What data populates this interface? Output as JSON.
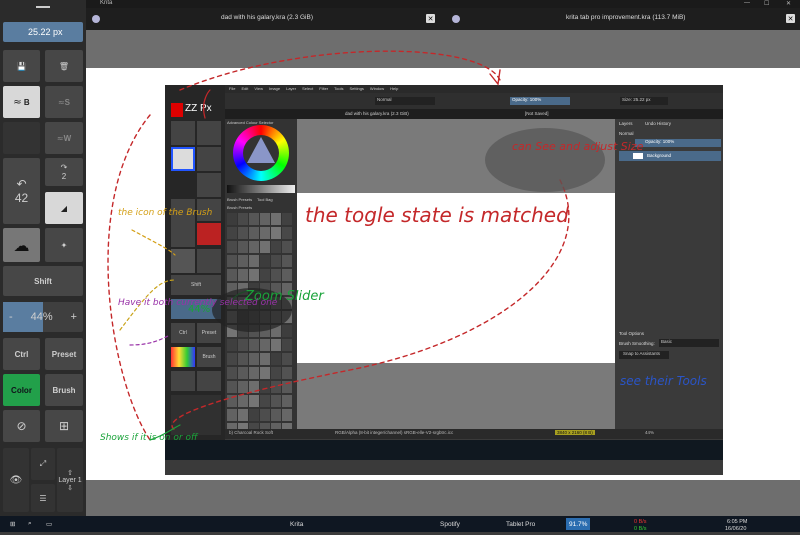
{
  "window": {
    "app_title": "Krita",
    "controls": [
      "—",
      "☐",
      "✕"
    ]
  },
  "tabs": [
    {
      "label": "dad with his galary.kra (2.3 GiB)",
      "close": "✕"
    },
    {
      "label": "krita  tab pro improvement.kra (113.7 MiB)",
      "close": "✕"
    }
  ],
  "toolbox": {
    "menu_icon": "hamburger-icon",
    "size_value": "25.22 px",
    "brush_b_label": "B",
    "brush_s_label": "S",
    "brush_w_label": "W",
    "undo_count": "42",
    "redo_count": "2",
    "shift_label": "Shift",
    "zoom_value": "44%",
    "zoom_minus": "-",
    "zoom_plus": "+",
    "ctrl_label": "Ctrl",
    "preset_label": "Preset",
    "color_label": "Color",
    "brush_label": "Brush",
    "layer_label": "Layer 1",
    "accent_green": "#22a04a"
  },
  "embedded": {
    "menu_items": [
      "File",
      "Edit",
      "View",
      "Image",
      "Layer",
      "Select",
      "Filter",
      "Tools",
      "Settings",
      "Window",
      "Help"
    ],
    "blend_mode": "Normal",
    "opacity": "Opacity: 100%",
    "size": "Size: 25.22 px",
    "tab_label": "dad with his galary.kra (2.3 GiB)",
    "not_saved": "[Not Saved]",
    "docker_title": "Advanced Colour Selector",
    "brush_presets_tab": "Brush Presets",
    "toolbox_tab": "Tool Bag",
    "brush_presets_header": "Brush Presets",
    "tag_label": "Tag",
    "layers_tab": "Layers",
    "undo_tab": "Undo History",
    "layer_mode": "Normal",
    "layer_opacity": "Opacity: 100%",
    "layer_name": "Background",
    "tool_options": "Tool Options",
    "brush_smoothing": "Brush Smoothing:",
    "smoothing_value": "Basic",
    "snap_label": "Snap to Assistants",
    "status_text": "RGB/Alpha (8-bit integer/channel)  sRGB-elle-V2-srgbtrc.icc",
    "brush_name": "b) Charcoal Rock Soft",
    "dimensions": "3840 x 2160 (8 B)",
    "zoom": "44%",
    "embed_zz": "ZZ Px",
    "shift": "Shift",
    "preset": "Preset",
    "brush": "Brush",
    "ctrl": "Ctrl"
  },
  "annotations": {
    "toggle_state": "the togle state is matched",
    "can_see_size": "can See and adjust Size",
    "zoom_slider": "Zoom Slider",
    "icon_brush": "the icon of the Brush",
    "have_both": "Have it both currently selected one",
    "shows_on_off": "Shows if it is on or off",
    "see_their_tools": "see their Tools",
    "zoom_label": "44%"
  },
  "taskbar": {
    "search_icon": "search-icon",
    "apps": [
      "Krita",
      "Spotify",
      "Tablet Pro"
    ],
    "battery": "91.7%",
    "net_up": "0 B/s",
    "net_down": "0 B/s",
    "time": "6:05 PM",
    "date": "16/06/20"
  }
}
